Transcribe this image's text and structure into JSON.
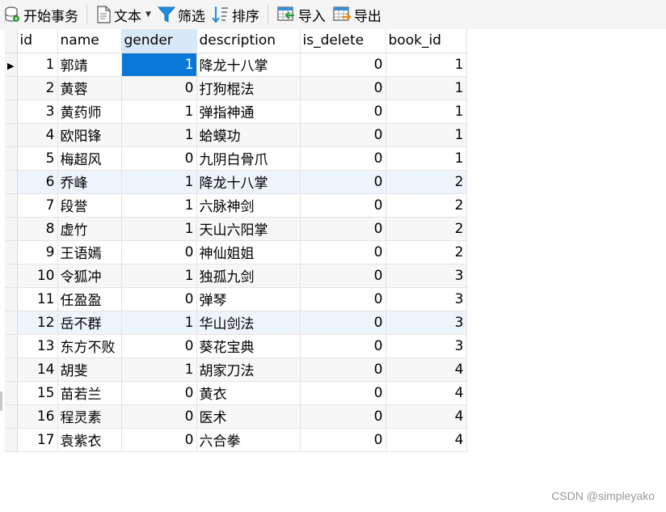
{
  "toolbar": {
    "begin_transaction": "开始事务",
    "text": "文本",
    "filter": "筛选",
    "sort": "排序",
    "import": "导入",
    "export": "导出"
  },
  "columns": [
    "id",
    "name",
    "gender",
    "description",
    "is_delete",
    "book_id"
  ],
  "selected_column": "gender",
  "rows": [
    {
      "id": "1",
      "name": "郭靖",
      "gender": "1",
      "description": "降龙十八掌",
      "is_delete": "0",
      "book_id": "1"
    },
    {
      "id": "2",
      "name": "黄蓉",
      "gender": "0",
      "description": "打狗棍法",
      "is_delete": "0",
      "book_id": "1"
    },
    {
      "id": "3",
      "name": "黄药师",
      "gender": "1",
      "description": "弹指神通",
      "is_delete": "0",
      "book_id": "1"
    },
    {
      "id": "4",
      "name": "欧阳锋",
      "gender": "1",
      "description": "蛤蟆功",
      "is_delete": "0",
      "book_id": "1"
    },
    {
      "id": "5",
      "name": "梅超风",
      "gender": "0",
      "description": "九阴白骨爪",
      "is_delete": "0",
      "book_id": "1"
    },
    {
      "id": "6",
      "name": "乔峰",
      "gender": "1",
      "description": "降龙十八掌",
      "is_delete": "0",
      "book_id": "2"
    },
    {
      "id": "7",
      "name": "段誉",
      "gender": "1",
      "description": "六脉神剑",
      "is_delete": "0",
      "book_id": "2"
    },
    {
      "id": "8",
      "name": "虚竹",
      "gender": "1",
      "description": "天山六阳掌",
      "is_delete": "0",
      "book_id": "2"
    },
    {
      "id": "9",
      "name": "王语嫣",
      "gender": "0",
      "description": "神仙姐姐",
      "is_delete": "0",
      "book_id": "2"
    },
    {
      "id": "10",
      "name": "令狐冲",
      "gender": "1",
      "description": "独孤九剑",
      "is_delete": "0",
      "book_id": "3"
    },
    {
      "id": "11",
      "name": "任盈盈",
      "gender": "0",
      "description": "弹琴",
      "is_delete": "0",
      "book_id": "3"
    },
    {
      "id": "12",
      "name": "岳不群",
      "gender": "1",
      "description": "华山剑法",
      "is_delete": "0",
      "book_id": "3"
    },
    {
      "id": "13",
      "name": "东方不败",
      "gender": "0",
      "description": "葵花宝典",
      "is_delete": "0",
      "book_id": "3"
    },
    {
      "id": "14",
      "name": "胡斐",
      "gender": "1",
      "description": "胡家刀法",
      "is_delete": "0",
      "book_id": "4"
    },
    {
      "id": "15",
      "name": "苗若兰",
      "gender": "0",
      "description": "黄衣",
      "is_delete": "0",
      "book_id": "4"
    },
    {
      "id": "16",
      "name": "程灵素",
      "gender": "0",
      "description": "医术",
      "is_delete": "0",
      "book_id": "4"
    },
    {
      "id": "17",
      "name": "袁紫衣",
      "gender": "0",
      "description": "六合拳",
      "is_delete": "0",
      "book_id": "4"
    }
  ],
  "watermark": "CSDN @simpleyako",
  "colors": {
    "selection": "#0a78d7",
    "header_selected": "#d9e8f7",
    "toolbar_bg": "#f5f5f5"
  }
}
